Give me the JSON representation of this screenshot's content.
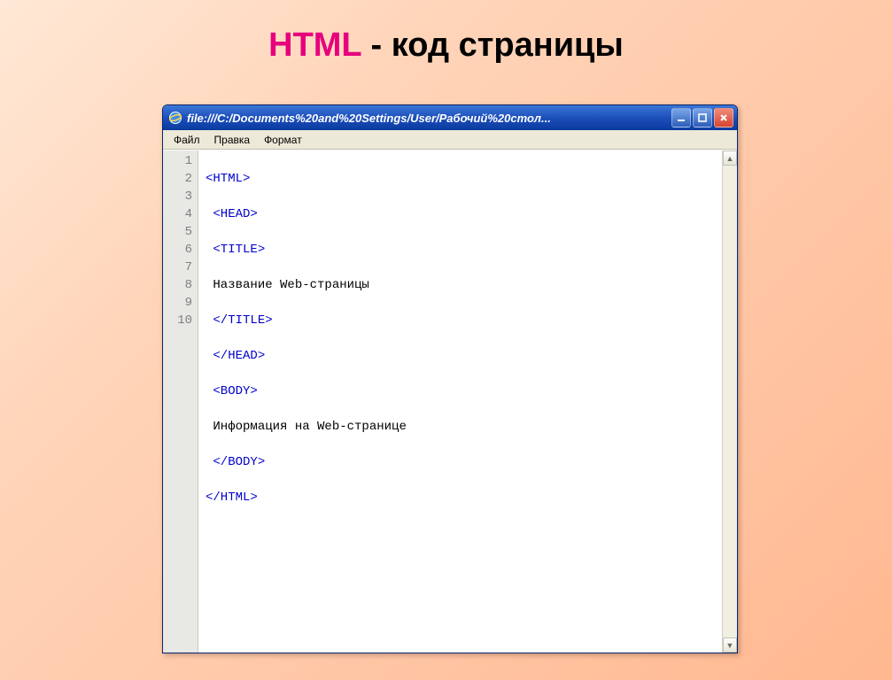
{
  "slide": {
    "title_accent": "HTML",
    "title_rest": " - код страницы"
  },
  "window": {
    "title": "file:///C:/Documents%20and%20Settings/User/Рабочий%20стол..."
  },
  "menu": {
    "file": "Файл",
    "edit": "Правка",
    "format": "Формат"
  },
  "gutter": {
    "l1": "1",
    "l2": "2",
    "l3": "3",
    "l4": "4",
    "l5": "5",
    "l6": "6",
    "l7": "7",
    "l8": "8",
    "l9": "9",
    "l10": "10"
  },
  "code": {
    "line1": "<HTML>",
    "line2": "<HEAD>",
    "line3": "<TITLE>",
    "line4": "Название Web-страницы",
    "line5": "</TITLE>",
    "line6": "</HEAD>",
    "line7": "<BODY>",
    "line8": "Информация на Web-странице",
    "line9": "</BODY>",
    "line10": "</HTML>",
    "indent1": " ",
    "indent0": ""
  }
}
